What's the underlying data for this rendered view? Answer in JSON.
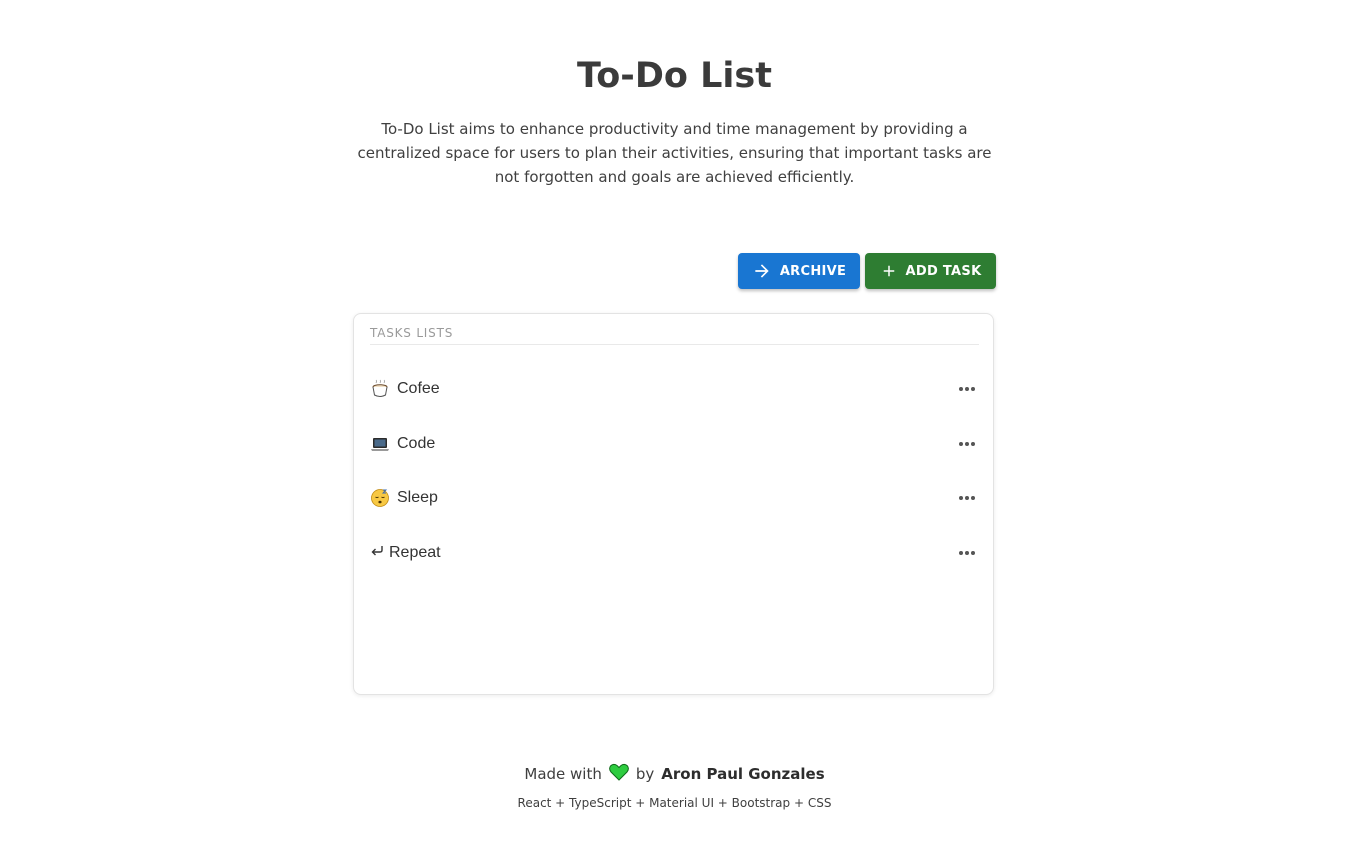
{
  "header": {
    "title": "To-Do List",
    "description": "To-Do List aims to enhance productivity and time management by providing a centralized space for users to plan their activities, ensuring that important tasks are not forgotten and goals are achieved efficiently."
  },
  "toolbar": {
    "archive_label": "ARCHIVE",
    "archive_icon": "arrow-right-icon",
    "archive_color": "#1976d2",
    "add_label": "ADD TASK",
    "add_icon": "plus-icon",
    "add_color": "#2e7d32"
  },
  "tasks": {
    "heading": "TASKS LISTS",
    "items": [
      {
        "emoji": "coffee-cup-emoji",
        "label": "Cofee"
      },
      {
        "emoji": "laptop-emoji",
        "label": "Code"
      },
      {
        "emoji": "sleeping-face-emoji",
        "label": "Sleep"
      },
      {
        "emoji": "return-arrow-glyph",
        "label": "Repeat"
      }
    ],
    "more_icon": "more-horizontal-icon"
  },
  "footer": {
    "made_with": "Made with",
    "heart_icon": "green-heart-icon",
    "heart_color": "#2ecc40",
    "by": "by",
    "author": "Aron Paul Gonzales",
    "stack": "React + TypeScript + Material UI + Bootstrap + CSS"
  }
}
